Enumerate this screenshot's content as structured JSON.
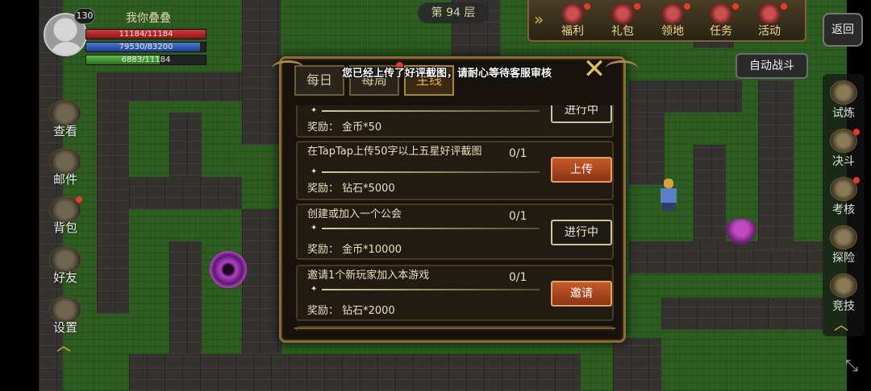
{
  "player": {
    "level": "130",
    "name": "我你叠叠",
    "hp_text": "11184/11184",
    "mp_text": "79530/83200",
    "xp_text": "6883/11184",
    "hp_fraction": 1.0,
    "mp_fraction": 0.956,
    "xp_fraction": 0.615
  },
  "floor_label": "第 94 层",
  "top_menu": {
    "arrow_icon": "double-chevron-right-icon",
    "items": [
      {
        "label": "福利",
        "icon": "gift-chest-icon",
        "badge": true
      },
      {
        "label": "礼包",
        "icon": "gift-bag-icon",
        "badge": true
      },
      {
        "label": "领地",
        "icon": "territory-icon",
        "badge": true
      },
      {
        "label": "任务",
        "icon": "task-scroll-icon",
        "badge": true
      },
      {
        "label": "活动",
        "icon": "event-icon",
        "badge": true
      }
    ]
  },
  "back_button": "返回",
  "auto_battle_button": "自动战斗",
  "right_menu": [
    {
      "label": "试炼",
      "icon": "trial-icon",
      "badge": false
    },
    {
      "label": "决斗",
      "icon": "crossed-swords-icon",
      "badge": true
    },
    {
      "label": "考核",
      "icon": "assessment-icon",
      "badge": true
    },
    {
      "label": "探险",
      "icon": "scroll-map-icon",
      "badge": false
    },
    {
      "label": "竞技",
      "icon": "arena-icon",
      "badge": false
    }
  ],
  "left_menu": [
    {
      "label": "查看",
      "icon": "book-icon",
      "badge": false
    },
    {
      "label": "邮件",
      "icon": "mail-icon",
      "badge": false
    },
    {
      "label": "背包",
      "icon": "bag-icon",
      "badge": true
    },
    {
      "label": "好友",
      "icon": "friends-icon",
      "badge": false
    },
    {
      "label": "设置",
      "icon": "gear-icon",
      "badge": false
    }
  ],
  "dialog": {
    "tabs": [
      "每日",
      "每周",
      "主线"
    ],
    "active_tab": 2,
    "tab_badge_index": 1,
    "toast": "您已经上传了好评截图，请耐心等待客服审核",
    "tasks": [
      {
        "desc": "",
        "progress": "",
        "reward": "奖励： 金币*50",
        "button": "进行中",
        "button_style": "wait"
      },
      {
        "desc": "在TapTap上传50字以上五星好评截图",
        "progress": "0/1",
        "reward": "奖励： 钻石*5000",
        "button": "上传",
        "button_style": "go"
      },
      {
        "desc": "创建或加入一个公会",
        "progress": "0/1",
        "reward": "奖励： 金币*10000",
        "button": "进行中",
        "button_style": "wait"
      },
      {
        "desc": "邀请1个新玩家加入本游戏",
        "progress": "0/1",
        "reward": "奖励： 钻石*2000",
        "button": "邀请",
        "button_style": "go"
      }
    ]
  },
  "colors": {
    "grass": "#2c5b1f",
    "wall": "#34322f",
    "accent_gold": "#e7b43d",
    "button_orange": "#c65a2a",
    "badge_red": "#e83a2a"
  }
}
